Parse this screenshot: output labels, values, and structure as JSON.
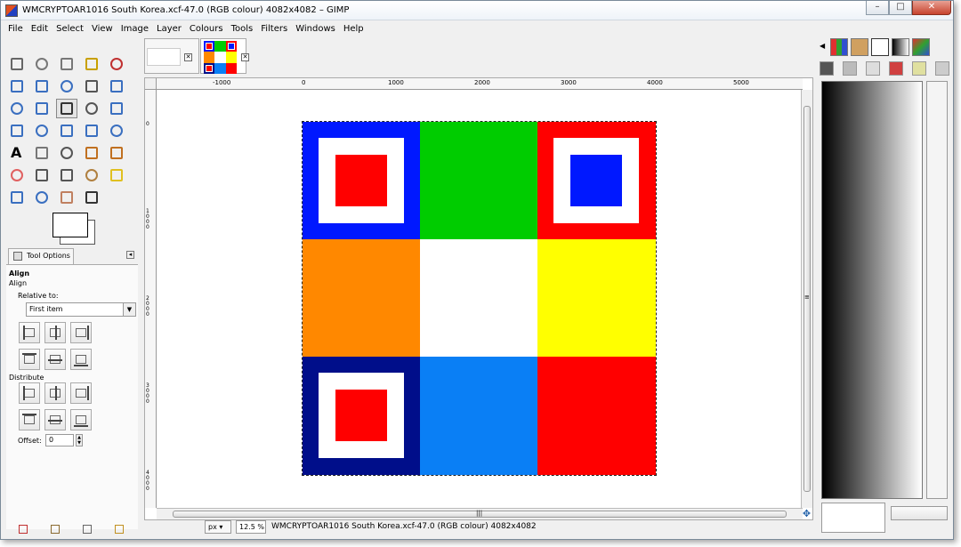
{
  "window": {
    "title": "WMCRYPTOAR1016 South Korea.xcf-47.0 (RGB colour) 4082x4082 – GIMP",
    "controls": {
      "minimize": "–",
      "maximize": "□",
      "close": "✕"
    }
  },
  "menubar": [
    "File",
    "Edit",
    "Select",
    "View",
    "Image",
    "Layer",
    "Colours",
    "Tools",
    "Filters",
    "Windows",
    "Help"
  ],
  "toolbox": {
    "tools": [
      {
        "name": "rect-select-icon",
        "color": "#666"
      },
      {
        "name": "ellipse-select-icon",
        "color": "#777"
      },
      {
        "name": "free-select-icon",
        "color": "#777"
      },
      {
        "name": "fuzzy-select-icon",
        "color": "#c8a000"
      },
      {
        "name": "color-select-icon",
        "color": "#c03030"
      },
      {
        "name": "scissors-icon",
        "color": "#3a6fc0"
      },
      {
        "name": "foreground-select-icon",
        "color": "#3a6fc0"
      },
      {
        "name": "paths-icon",
        "color": "#3a6fc0"
      },
      {
        "name": "color-picker-icon",
        "color": "#555"
      },
      {
        "name": "zoom-icon",
        "color": "#3a6fc0"
      },
      {
        "name": "measure-icon",
        "color": "#3a6fc0"
      },
      {
        "name": "move-icon",
        "color": "#3a6fc0"
      },
      {
        "name": "align-icon",
        "color": "#333"
      },
      {
        "name": "crop-icon",
        "color": "#555"
      },
      {
        "name": "rotate-icon",
        "color": "#3a6fc0"
      },
      {
        "name": "scale-icon",
        "color": "#3a6fc0"
      },
      {
        "name": "shear-icon",
        "color": "#3a6fc0"
      },
      {
        "name": "perspective-icon",
        "color": "#3a6fc0"
      },
      {
        "name": "flip-icon",
        "color": "#3a6fc0"
      },
      {
        "name": "cage-icon",
        "color": "#3a6fc0"
      },
      {
        "name": "text-icon",
        "color": "#000"
      },
      {
        "name": "bucket-fill-icon",
        "color": "#777"
      },
      {
        "name": "blend-icon",
        "color": "#555"
      },
      {
        "name": "pencil-icon",
        "color": "#c07020"
      },
      {
        "name": "paintbrush-icon",
        "color": "#c07020"
      },
      {
        "name": "eraser-icon",
        "color": "#e06060"
      },
      {
        "name": "airbrush-icon",
        "color": "#555"
      },
      {
        "name": "ink-icon",
        "color": "#555"
      },
      {
        "name": "clone-icon",
        "color": "#b08040"
      },
      {
        "name": "heal-icon",
        "color": "#e0c020"
      },
      {
        "name": "perspective-clone-icon",
        "color": "#3a6fc0"
      },
      {
        "name": "blur-icon",
        "color": "#3a6fc0"
      },
      {
        "name": "smudge-icon",
        "color": "#c08060"
      },
      {
        "name": "dodge-burn-icon",
        "color": "#333"
      }
    ],
    "fg_color": "#ffffff",
    "bg_color": "#ffffff"
  },
  "tool_options": {
    "tab_label": "Tool Options",
    "menu_glyph": "◂",
    "heading": "Align",
    "subheading": "Align",
    "relative_label": "Relative to:",
    "relative_value": "First item",
    "distribute_label": "Distribute",
    "offset_label": "Offset:",
    "offset_value": "0"
  },
  "image_tabs": [
    {
      "name": "tab-blank-image",
      "close": "✕"
    },
    {
      "name": "tab-south-korea-image",
      "close": "✕"
    }
  ],
  "ruler": {
    "h_labels": [
      "-1000",
      "0",
      "1000",
      "2000",
      "3000",
      "4000",
      "5000"
    ],
    "v_labels": [
      "0",
      "1000",
      "2000",
      "3000",
      "4000"
    ]
  },
  "canvas": {
    "cells": [
      {
        "bg": "#0018ff",
        "white": true,
        "inner": "#ff0000"
      },
      {
        "bg": "#00cc00",
        "white": false,
        "inner": null
      },
      {
        "bg": "#ff0000",
        "white": true,
        "inner": "#0018ff"
      },
      {
        "bg": "#ff8800",
        "white": false,
        "inner": null
      },
      {
        "bg": "#ffffff",
        "white": false,
        "inner": null
      },
      {
        "bg": "#ffff00",
        "white": false,
        "inner": null
      },
      {
        "bg": "#000e8a",
        "white": true,
        "inner": "#ff0000"
      },
      {
        "bg": "#0a7ff5",
        "white": false,
        "inner": null
      },
      {
        "bg": "#ff0000",
        "white": false,
        "inner": null
      }
    ],
    "nav_glyph": "✥",
    "hscroll_glyph": "|||",
    "vscroll_glyph": "≡"
  },
  "statusbar": {
    "unit": "px",
    "zoom": "12.5 %",
    "text": "WMCRYPTOAR1016 South Korea.xcf-47.0 (RGB colour) 4082x4082"
  },
  "dock": {
    "arrow": "◀"
  }
}
